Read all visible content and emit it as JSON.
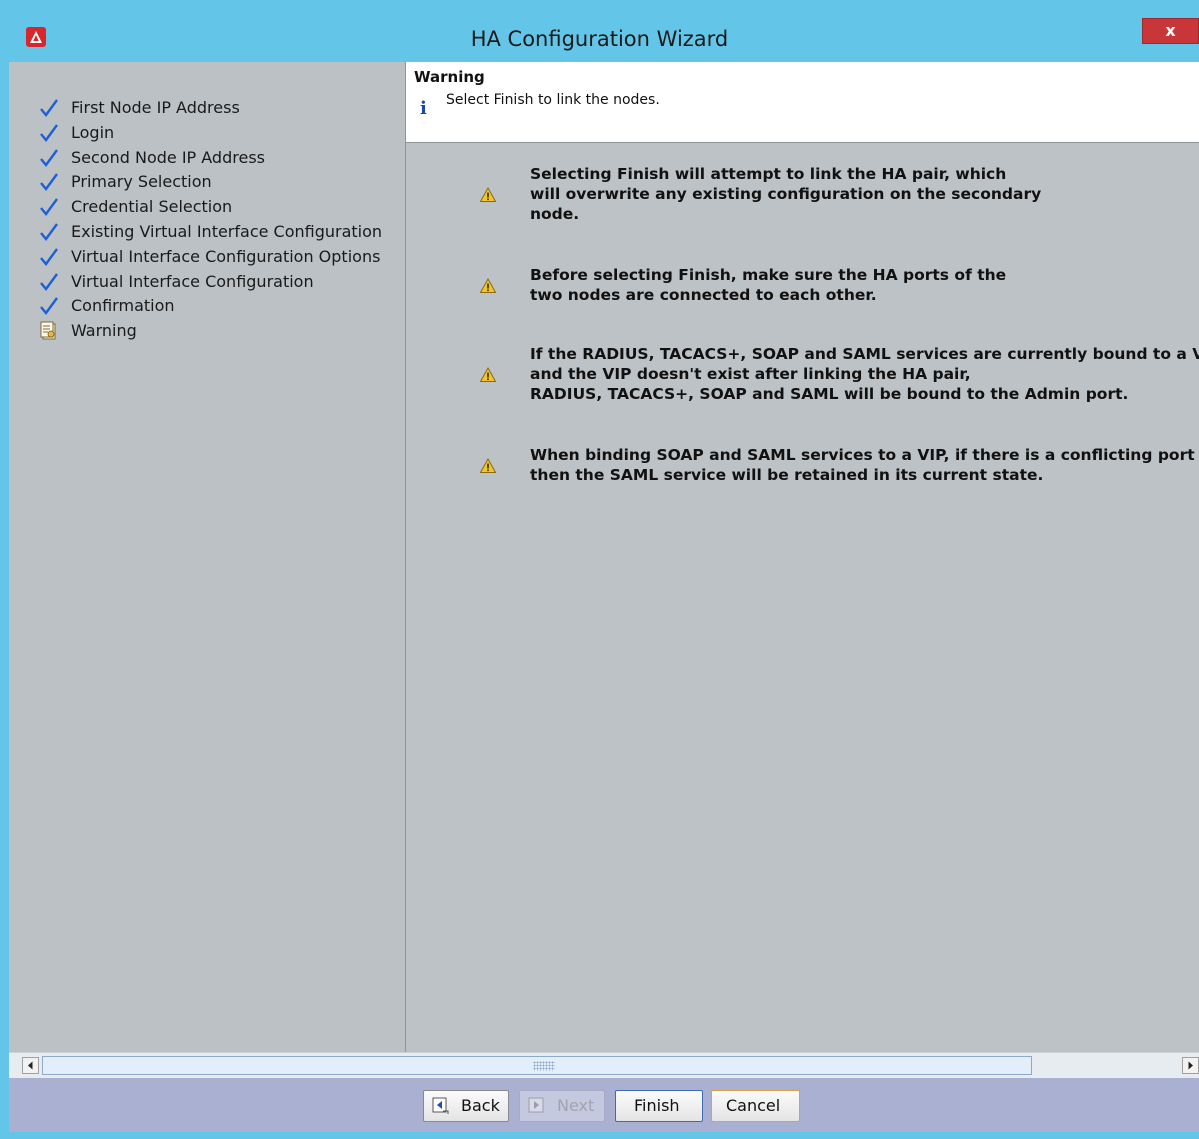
{
  "window": {
    "title": "HA Configuration Wizard",
    "close_label": "x"
  },
  "sidebar": {
    "steps": [
      {
        "label": "First Node IP Address",
        "status": "completed"
      },
      {
        "label": "Login",
        "status": "completed"
      },
      {
        "label": "Second Node IP Address",
        "status": "completed"
      },
      {
        "label": "Primary Selection",
        "status": "completed"
      },
      {
        "label": "Credential Selection",
        "status": "completed"
      },
      {
        "label": "Existing Virtual Interface Configuration",
        "status": "completed"
      },
      {
        "label": "Virtual Interface Configuration Options",
        "status": "completed"
      },
      {
        "label": "Virtual Interface Configuration",
        "status": "completed"
      },
      {
        "label": "Confirmation",
        "status": "completed"
      },
      {
        "label": "Warning",
        "status": "current"
      }
    ]
  },
  "header": {
    "title": "Warning",
    "message": "Select Finish to link the nodes."
  },
  "messages": [
    {
      "text": "Selecting Finish will attempt to link the HA pair, which\nwill overwrite any existing configuration on the secondary\nnode."
    },
    {
      "text": "Before selecting Finish, make sure the HA ports of the\ntwo nodes are connected to each other."
    },
    {
      "text": "If the RADIUS, TACACS+, SOAP and SAML services are currently bound to a VIP\nand the VIP doesn't exist after linking the HA pair,\nRADIUS, TACACS+, SOAP and SAML will be bound to the Admin port."
    },
    {
      "text": "When binding SOAP and SAML services to a VIP, if there is a conflicting port config\nthen the SAML service will be retained in its current state."
    }
  ],
  "buttons": {
    "back": "Back",
    "next": "Next",
    "finish": "Finish",
    "cancel": "Cancel"
  },
  "colors": {
    "titlebar": "#63c5e8",
    "panel": "#bdc2c6",
    "buttonbar": "#aab0d2",
    "check": "#1f5fd6"
  }
}
